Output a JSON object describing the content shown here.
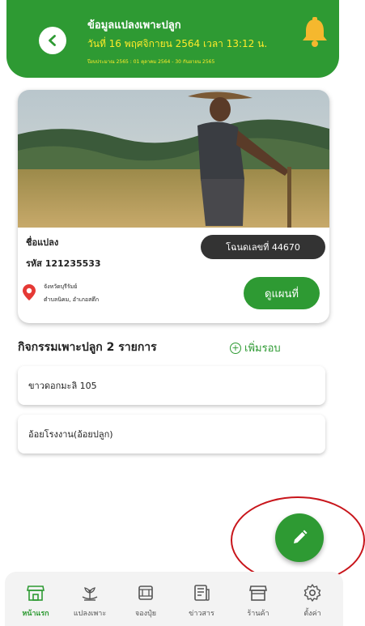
{
  "header": {
    "title": "ข้อมูลแปลงเพาะปลูก",
    "date": "วันที่ 16 พฤศจิกายน 2564 เวลา 13:12 น.",
    "period": "ปีงบประมาณ 2565 : 01 ตุลาคม 2564 - 30 กันยายน 2565",
    "back_icon": "chevron-left-icon",
    "bell_icon": "bell-icon",
    "accent_color": "#2e9a33",
    "highlight_color": "#ffeb2a"
  },
  "plot_card": {
    "image_icon": "farmer-photo",
    "name_label": "ชื่อแปลง",
    "code_label": "รหัส 121235533",
    "deed_badge": "โฉนดเลขที่ 44670",
    "province": "จังหวัดบุรีรัมย์",
    "district": "ตำบลนิคม, อำเภอสตึก",
    "map_button": "ดูแผนที่"
  },
  "activities": {
    "title": "กิจกรรมเพาะปลูก 2 รายการ",
    "add_label": "เพิ่มรอบ",
    "items": [
      {
        "label": "ขาวดอกมะลิ 105"
      },
      {
        "label": "อ้อยโรงงาน(อ้อยปลูก)"
      }
    ]
  },
  "fab": {
    "icon": "pencil-icon"
  },
  "nav": {
    "items": [
      {
        "label": "หน้าแรก",
        "icon": "store-icon",
        "active": true
      },
      {
        "label": "แปลงเพาะ",
        "icon": "plant-icon",
        "active": false
      },
      {
        "label": "จองปุ๋ย",
        "icon": "sack-icon",
        "active": false
      },
      {
        "label": "ข่าวสาร",
        "icon": "news-icon",
        "active": false
      },
      {
        "label": "ร้านค้า",
        "icon": "shop-icon",
        "active": false
      },
      {
        "label": "ตั้งค่า",
        "icon": "gear-icon",
        "active": false
      }
    ]
  }
}
